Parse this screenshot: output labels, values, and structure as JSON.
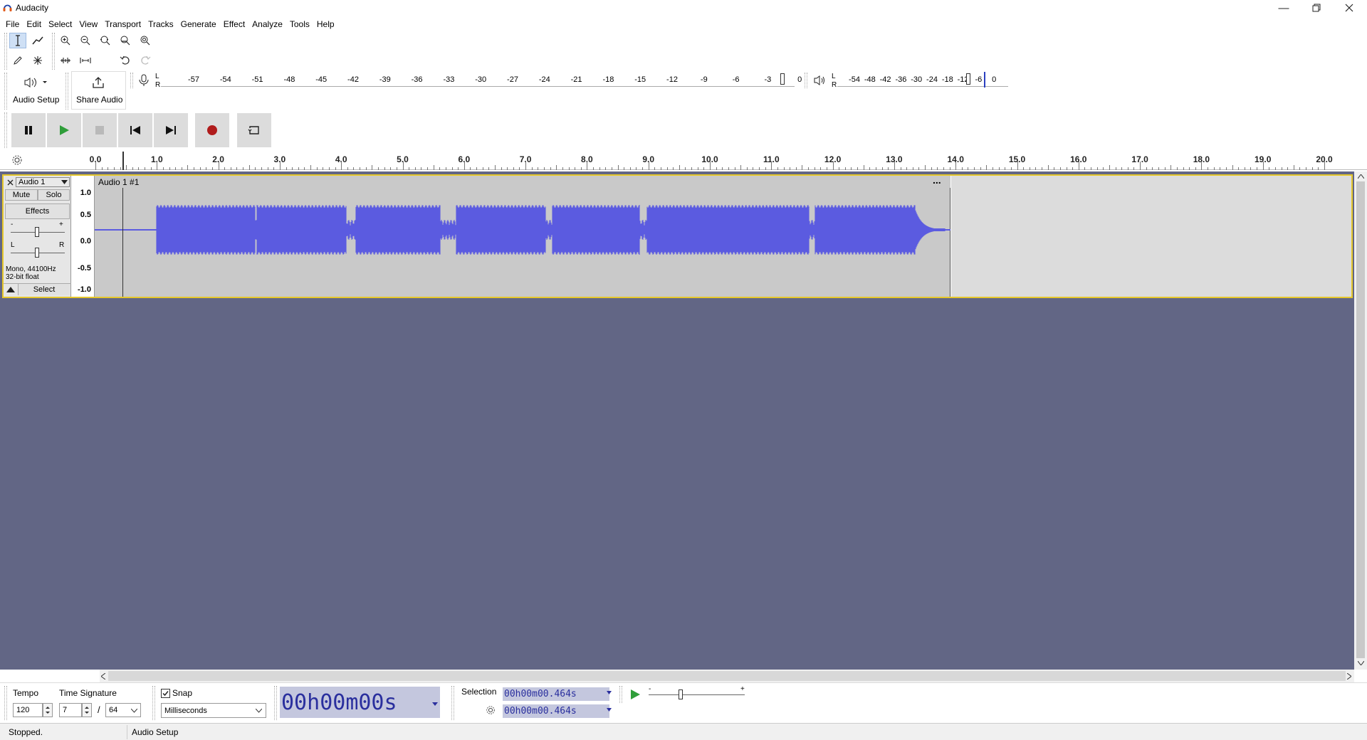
{
  "window": {
    "title": "Audacity"
  },
  "menu": [
    "File",
    "Edit",
    "Select",
    "View",
    "Transport",
    "Tracks",
    "Generate",
    "Effect",
    "Analyze",
    "Tools",
    "Help"
  ],
  "toolbar": {
    "audio_setup_label": "Audio Setup",
    "share_audio_label": "Share Audio"
  },
  "meters": {
    "record_lr": [
      "L",
      "R"
    ],
    "record_ticks": [
      "-57",
      "-54",
      "-51",
      "-48",
      "-45",
      "-42",
      "-39",
      "-36",
      "-33",
      "-30",
      "-27",
      "-24",
      "-21",
      "-18",
      "-15",
      "-12",
      "-9",
      "-6",
      "-3",
      "0"
    ],
    "play_lr": [
      "L",
      "R"
    ],
    "play_ticks": [
      "-54",
      "-48",
      "-42",
      "-36",
      "-30",
      "-24",
      "-18",
      "-12",
      "-6",
      "0"
    ]
  },
  "ruler": {
    "labels": [
      "0.0",
      "1.0",
      "2.0",
      "3.0",
      "4.0",
      "5.0",
      "6.0",
      "7.0",
      "8.0",
      "9.0",
      "10.0",
      "11.0",
      "12.0",
      "13.0",
      "14.0",
      "15.0",
      "16.0",
      "17.0",
      "18.0",
      "19.0",
      "20.0"
    ]
  },
  "track": {
    "name": "Audio 1",
    "mute_label": "Mute",
    "solo_label": "Solo",
    "effects_label": "Effects",
    "gain_minus": "-",
    "gain_plus": "+",
    "pan_left": "L",
    "pan_right": "R",
    "info_line1": "Mono, 44100Hz",
    "info_line2": "32-bit float",
    "select_label": "Select",
    "clip_name": "Audio 1 #1",
    "clip_menu": "...",
    "vruler": [
      "1.0",
      "0.5",
      "0.0",
      "-0.5",
      "-1.0"
    ],
    "waveform_color": "#5b5be0"
  },
  "bottom": {
    "tempo_label": "Tempo",
    "tempo_value": "120",
    "timesig_label": "Time Signature",
    "timesig_num": "7",
    "timesig_slash": "/",
    "timesig_den": "64",
    "snap_label": "Snap",
    "snap_checked": true,
    "snap_unit": "Milliseconds",
    "time_h": "00",
    "time_m": "00",
    "time_s": "00",
    "unit_h": "h",
    "unit_m": "m",
    "unit_s": "s",
    "selection_label": "Selection",
    "sel_start": "00h00m00.464s",
    "sel_end": "00h00m00.464s",
    "speed_minus": "-",
    "speed_plus": "+"
  },
  "status": {
    "state": "Stopped.",
    "message": "Audio Setup"
  }
}
